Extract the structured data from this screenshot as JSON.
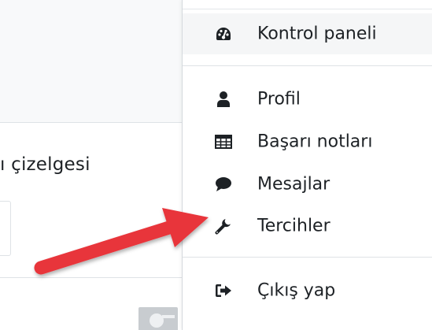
{
  "background": {
    "title_fragment": "ı çizelgesi"
  },
  "user_menu": {
    "items": [
      {
        "label": "Kontrol paneli",
        "icon": "tachometer-icon"
      },
      {
        "label": "Profil",
        "icon": "user-icon"
      },
      {
        "label": "Başarı notları",
        "icon": "table-icon"
      },
      {
        "label": "Mesajlar",
        "icon": "comment-icon"
      },
      {
        "label": "Tercihler",
        "icon": "wrench-icon"
      },
      {
        "label": "Çıkış yap",
        "icon": "sign-out-icon"
      }
    ]
  },
  "colors": {
    "annotation_arrow": "#e8353b",
    "icon": "#1d2125"
  }
}
